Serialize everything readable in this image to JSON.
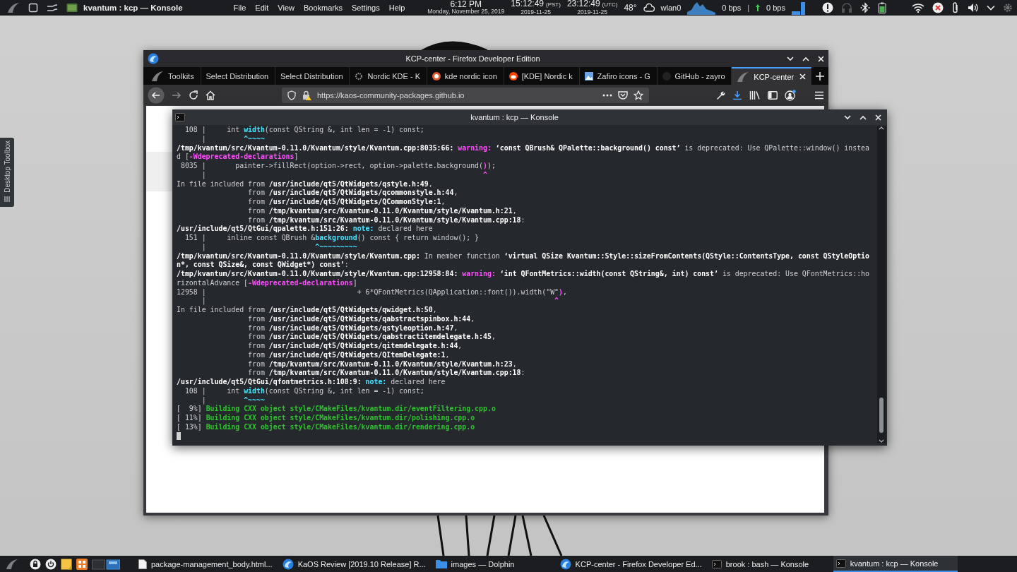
{
  "top_panel": {
    "app_title": "kvantum : kcp — Konsole",
    "menu": [
      "File",
      "Edit",
      "View",
      "Bookmarks",
      "Settings",
      "Help"
    ],
    "clock": {
      "time": "6:12 PM",
      "date": "Monday, November 25, 2019"
    },
    "world_clocks": [
      {
        "time": "15:12:49",
        "zone": "(PST)",
        "date": "2019-11-25"
      },
      {
        "time": "23:12:49",
        "zone": "(UTC)",
        "date": "2019-11-25"
      }
    ],
    "temperature": "48°",
    "network": {
      "interface": "wlan0",
      "down": "0 bps",
      "separator": "|",
      "up": "0 bps"
    }
  },
  "desktop_toolbox": {
    "label": "Desktop Toolbox"
  },
  "firefox": {
    "title": "KCP-center - Firefox Developer Edition",
    "tabs": [
      {
        "label": "Toolkits",
        "selected": false
      },
      {
        "label": "Select Distribution",
        "selected": false
      },
      {
        "label": "Select Distribution",
        "selected": false
      },
      {
        "label": "Nordic KDE - K",
        "selected": false
      },
      {
        "label": "kde nordic icon",
        "selected": false
      },
      {
        "label": "[KDE] Nordic k",
        "selected": false
      },
      {
        "label": "Zafiro icons - G",
        "selected": false
      },
      {
        "label": "GitHub - zayro",
        "selected": false
      },
      {
        "label": "KCP-center",
        "selected": true
      }
    ],
    "url": "https://kaos-community-packages.github.io"
  },
  "konsole": {
    "title": "kvantum : kcp — Konsole",
    "lines": [
      {
        "segments": [
          {
            "kind": "plain",
            "text": "  108 |     int "
          },
          {
            "kind": "note",
            "text": "width"
          },
          {
            "kind": "plain",
            "text": "(const QString &, int len = -1) const;"
          }
        ]
      },
      {
        "segments": [
          {
            "kind": "plain",
            "text": "      |         "
          },
          {
            "kind": "note",
            "text": "^~~~~"
          }
        ]
      },
      {
        "segments": [
          {
            "kind": "bold",
            "text": "/tmp/kvantum/src/Kvantum-0.11.0/Kvantum/style/Kvantum.cpp:8035:66: "
          },
          {
            "kind": "warning",
            "text": "warning: "
          },
          {
            "kind": "bold",
            "text": "‘const QBrush& QPalette::background() const’"
          },
          {
            "kind": "plain",
            "text": " is deprecated: Use QPalette::window() instea"
          }
        ]
      },
      {
        "segments": [
          {
            "kind": "plain",
            "text": "d ["
          },
          {
            "kind": "warning",
            "text": "-Wdeprecated-declarations"
          },
          {
            "kind": "plain",
            "text": "]"
          }
        ]
      },
      {
        "segments": [
          {
            "kind": "plain",
            "text": " 8035 |       painter->fillRect(option->rect, option->palette.background("
          },
          {
            "kind": "warning",
            "text": ")"
          },
          {
            "kind": "plain",
            "text": ");"
          }
        ]
      },
      {
        "segments": [
          {
            "kind": "plain",
            "text": "      |                                                                  "
          },
          {
            "kind": "warning",
            "text": "^"
          }
        ]
      },
      {
        "segments": [
          {
            "kind": "plain",
            "text": "In file included from "
          },
          {
            "kind": "bold",
            "text": "/usr/include/qt5/QtWidgets/qstyle.h:49"
          },
          {
            "kind": "plain",
            "text": ","
          }
        ]
      },
      {
        "segments": [
          {
            "kind": "plain",
            "text": "                 from "
          },
          {
            "kind": "bold",
            "text": "/usr/include/qt5/QtWidgets/qcommonstyle.h:44"
          },
          {
            "kind": "plain",
            "text": ","
          }
        ]
      },
      {
        "segments": [
          {
            "kind": "plain",
            "text": "                 from "
          },
          {
            "kind": "bold",
            "text": "/usr/include/qt5/QtWidgets/QCommonStyle:1"
          },
          {
            "kind": "plain",
            "text": ","
          }
        ]
      },
      {
        "segments": [
          {
            "kind": "plain",
            "text": "                 from "
          },
          {
            "kind": "bold",
            "text": "/tmp/kvantum/src/Kvantum-0.11.0/Kvantum/style/Kvantum.h:21"
          },
          {
            "kind": "plain",
            "text": ","
          }
        ]
      },
      {
        "segments": [
          {
            "kind": "plain",
            "text": "                 from "
          },
          {
            "kind": "bold",
            "text": "/tmp/kvantum/src/Kvantum-0.11.0/Kvantum/style/Kvantum.cpp:18"
          },
          {
            "kind": "plain",
            "text": ":"
          }
        ]
      },
      {
        "segments": [
          {
            "kind": "bold",
            "text": "/usr/include/qt5/QtGui/qpalette.h:151:26: "
          },
          {
            "kind": "note",
            "text": "note: "
          },
          {
            "kind": "plain",
            "text": "declared here"
          }
        ]
      },
      {
        "segments": [
          {
            "kind": "plain",
            "text": "  151 |     inline const QBrush &"
          },
          {
            "kind": "note",
            "text": "background"
          },
          {
            "kind": "plain",
            "text": "() const { return window(); }"
          }
        ]
      },
      {
        "segments": [
          {
            "kind": "plain",
            "text": "      |                          "
          },
          {
            "kind": "note",
            "text": "^~~~~~~~~~"
          }
        ]
      },
      {
        "segments": [
          {
            "kind": "bold",
            "text": "/tmp/kvantum/src/Kvantum-0.11.0/Kvantum/style/Kvantum.cpp:"
          },
          {
            "kind": "plain",
            "text": " In member function "
          },
          {
            "kind": "bold",
            "text": "‘virtual QSize Kvantum::Style::sizeFromContents(QStyle::ContentsType, const QStyleOptio"
          }
        ]
      },
      {
        "segments": [
          {
            "kind": "bold",
            "text": "n*, const QSize&, const QWidget*) const’"
          },
          {
            "kind": "plain",
            "text": ":"
          }
        ]
      },
      {
        "segments": [
          {
            "kind": "bold",
            "text": "/tmp/kvantum/src/Kvantum-0.11.0/Kvantum/style/Kvantum.cpp:12958:84: "
          },
          {
            "kind": "warning",
            "text": "warning: "
          },
          {
            "kind": "bold",
            "text": "‘int QFontMetrics::width(const QString&, int) const’"
          },
          {
            "kind": "plain",
            "text": " is deprecated: Use QFontMetrics::ho"
          }
        ]
      },
      {
        "segments": [
          {
            "kind": "plain",
            "text": "rizontalAdvance ["
          },
          {
            "kind": "warning",
            "text": "-Wdeprecated-declarations"
          },
          {
            "kind": "plain",
            "text": "]"
          }
        ]
      },
      {
        "segments": [
          {
            "kind": "plain",
            "text": "12958 |                                    + 6*QFontMetrics(QApplication::font()).width(\"W\""
          },
          {
            "kind": "warning",
            "text": ")"
          },
          {
            "kind": "plain",
            "text": ","
          }
        ]
      },
      {
        "segments": [
          {
            "kind": "plain",
            "text": "      |                                                                                   "
          },
          {
            "kind": "warning",
            "text": "^"
          }
        ]
      },
      {
        "segments": [
          {
            "kind": "plain",
            "text": "In file included from "
          },
          {
            "kind": "bold",
            "text": "/usr/include/qt5/QtWidgets/qwidget.h:50"
          },
          {
            "kind": "plain",
            "text": ","
          }
        ]
      },
      {
        "segments": [
          {
            "kind": "plain",
            "text": "                 from "
          },
          {
            "kind": "bold",
            "text": "/usr/include/qt5/QtWidgets/qabstractspinbox.h:44"
          },
          {
            "kind": "plain",
            "text": ","
          }
        ]
      },
      {
        "segments": [
          {
            "kind": "plain",
            "text": "                 from "
          },
          {
            "kind": "bold",
            "text": "/usr/include/qt5/QtWidgets/qstyleoption.h:47"
          },
          {
            "kind": "plain",
            "text": ","
          }
        ]
      },
      {
        "segments": [
          {
            "kind": "plain",
            "text": "                 from "
          },
          {
            "kind": "bold",
            "text": "/usr/include/qt5/QtWidgets/qabstractitemdelegate.h:45"
          },
          {
            "kind": "plain",
            "text": ","
          }
        ]
      },
      {
        "segments": [
          {
            "kind": "plain",
            "text": "                 from "
          },
          {
            "kind": "bold",
            "text": "/usr/include/qt5/QtWidgets/qitemdelegate.h:44"
          },
          {
            "kind": "plain",
            "text": ","
          }
        ]
      },
      {
        "segments": [
          {
            "kind": "plain",
            "text": "                 from "
          },
          {
            "kind": "bold",
            "text": "/usr/include/qt5/QtWidgets/QItemDelegate:1"
          },
          {
            "kind": "plain",
            "text": ","
          }
        ]
      },
      {
        "segments": [
          {
            "kind": "plain",
            "text": "                 from "
          },
          {
            "kind": "bold",
            "text": "/tmp/kvantum/src/Kvantum-0.11.0/Kvantum/style/Kvantum.h:23"
          },
          {
            "kind": "plain",
            "text": ","
          }
        ]
      },
      {
        "segments": [
          {
            "kind": "plain",
            "text": "                 from "
          },
          {
            "kind": "bold",
            "text": "/tmp/kvantum/src/Kvantum-0.11.0/Kvantum/style/Kvantum.cpp:18"
          },
          {
            "kind": "plain",
            "text": ":"
          }
        ]
      },
      {
        "segments": [
          {
            "kind": "bold",
            "text": "/usr/include/qt5/QtGui/qfontmetrics.h:108:9: "
          },
          {
            "kind": "note",
            "text": "note: "
          },
          {
            "kind": "plain",
            "text": "declared here"
          }
        ]
      },
      {
        "segments": [
          {
            "kind": "plain",
            "text": "  108 |     int "
          },
          {
            "kind": "note",
            "text": "width"
          },
          {
            "kind": "plain",
            "text": "(const QString &, int len = -1) const;"
          }
        ]
      },
      {
        "segments": [
          {
            "kind": "plain",
            "text": "      |         "
          },
          {
            "kind": "note",
            "text": "^~~~~"
          }
        ]
      },
      {
        "segments": [
          {
            "kind": "plain",
            "text": "[  9%] "
          },
          {
            "kind": "green",
            "text": "Building CXX object style/CMakeFiles/kvantum.dir/eventFiltering.cpp.o"
          }
        ]
      },
      {
        "segments": [
          {
            "kind": "plain",
            "text": "[ 11%] "
          },
          {
            "kind": "green",
            "text": "Building CXX object style/CMakeFiles/kvantum.dir/polishing.cpp.o"
          }
        ]
      },
      {
        "segments": [
          {
            "kind": "plain",
            "text": "[ 13%] "
          },
          {
            "kind": "green",
            "text": "Building CXX object style/CMakeFiles/kvantum.dir/rendering.cpp.o"
          }
        ]
      }
    ]
  },
  "taskbar": {
    "tasks": [
      {
        "label": "package-management_body.html...",
        "selected": false
      },
      {
        "label": "KaOS Review [2019.10 Release] R...",
        "selected": false
      },
      {
        "label": "images — Dolphin",
        "selected": false
      },
      {
        "label": "KCP-center - Firefox Developer Ed...",
        "selected": false
      },
      {
        "label": "brook : bash — Konsole",
        "selected": false
      },
      {
        "label": "kvantum : kcp — Konsole",
        "selected": true
      }
    ]
  }
}
